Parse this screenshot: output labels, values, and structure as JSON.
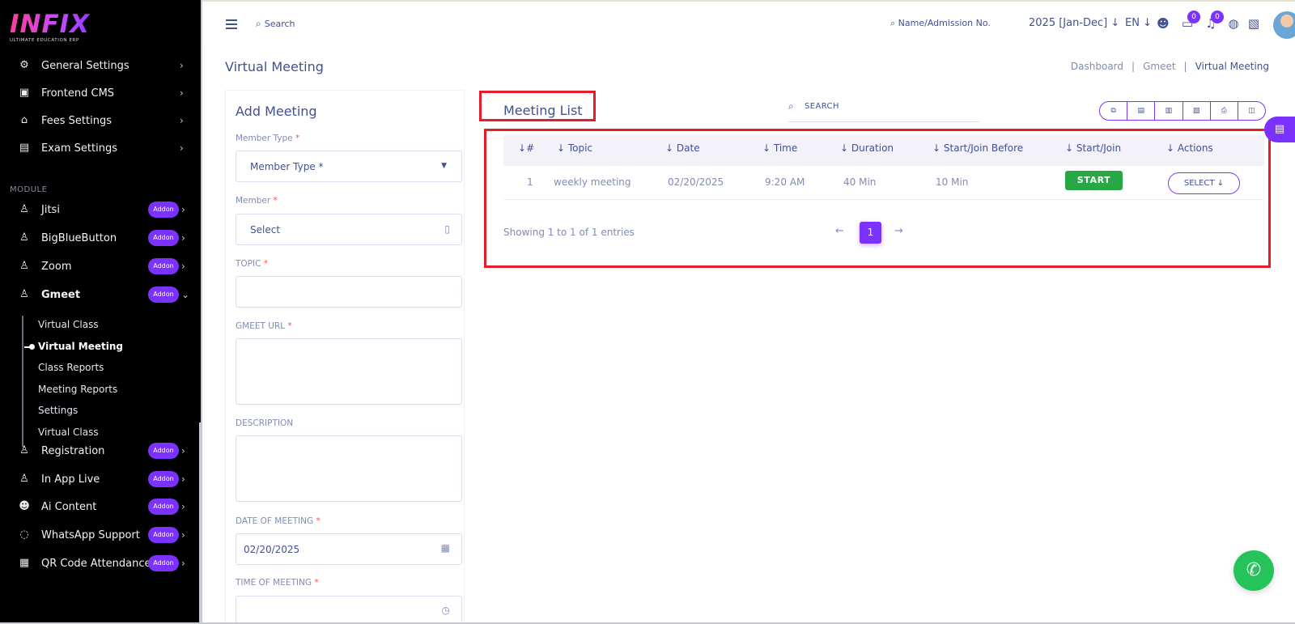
{
  "logo": {
    "text": "INFIX",
    "sub": "ULTIMATE EDUCATION ERP"
  },
  "sidebar": {
    "top_items": [
      {
        "label": "General Settings",
        "icon": "gears-icon"
      },
      {
        "label": "Frontend CMS",
        "icon": "monitor-icon"
      },
      {
        "label": "Fees Settings",
        "icon": "bank-icon"
      },
      {
        "label": "Exam Settings",
        "icon": "book-icon"
      }
    ],
    "module_label": "MODULE",
    "module_items": [
      {
        "label": "Jitsi",
        "addon": "Addon"
      },
      {
        "label": "BigBlueButton",
        "addon": "Addon"
      },
      {
        "label": "Zoom",
        "addon": "Addon"
      },
      {
        "label": "Gmeet",
        "addon": "Addon"
      }
    ],
    "gmeet_sub": [
      "Virtual Class",
      "Virtual Meeting",
      "Class Reports",
      "Meeting Reports",
      "Settings",
      "Virtual Class"
    ],
    "bottom_items": [
      {
        "label": "Registration",
        "addon": "Addon"
      },
      {
        "label": "In App Live",
        "addon": "Addon"
      },
      {
        "label": "Ai Content",
        "addon": "Addon"
      },
      {
        "label": "WhatsApp Support",
        "addon": "Addon"
      },
      {
        "label": "QR Code Attendance",
        "addon": "Addon"
      }
    ]
  },
  "topbar": {
    "search": "Search",
    "name_search": "Name/Admission No.",
    "year": "2025 [Jan-Dec]",
    "lang": "EN",
    "chat_badge": "0",
    "bell_badge": "0"
  },
  "page": {
    "title": "Virtual Meeting",
    "breadcrumb": [
      "Dashboard",
      "Gmeet",
      "Virtual Meeting"
    ]
  },
  "add_form": {
    "title": "Add Meeting",
    "member_type_label": "Member Type",
    "member_type_placeholder": "Member Type *",
    "member_label": "Member",
    "member_placeholder": "Select",
    "topic_label": "TOPIC",
    "url_label": "GMEET URL",
    "desc_label": "DESCRIPTION",
    "date_label": "DATE OF MEETING",
    "date_value": "02/20/2025",
    "time_label": "TIME OF MEETING",
    "required_mark": "*"
  },
  "list": {
    "title": "Meeting List",
    "search_placeholder": "SEARCH",
    "columns": [
      "#",
      "Topic",
      "Date",
      "Time",
      "Duration",
      "Start/Join Before",
      "Start/Join",
      "Actions"
    ],
    "rows": [
      {
        "n": "1",
        "topic": "weekly meeting",
        "date": "02/20/2025",
        "time": "9:20 AM",
        "duration": "40 Min",
        "before": "10 Min",
        "start_label": "START",
        "action_label": "SELECT"
      }
    ],
    "showing": "Showing 1 to 1 of 1 entries",
    "page": "1"
  },
  "colors": {
    "accent": "#7c32ff",
    "text": "#415094",
    "muted": "#828bb2",
    "success": "#27a844",
    "highlight": "#e41e2a",
    "whatsapp": "#25c35a"
  }
}
